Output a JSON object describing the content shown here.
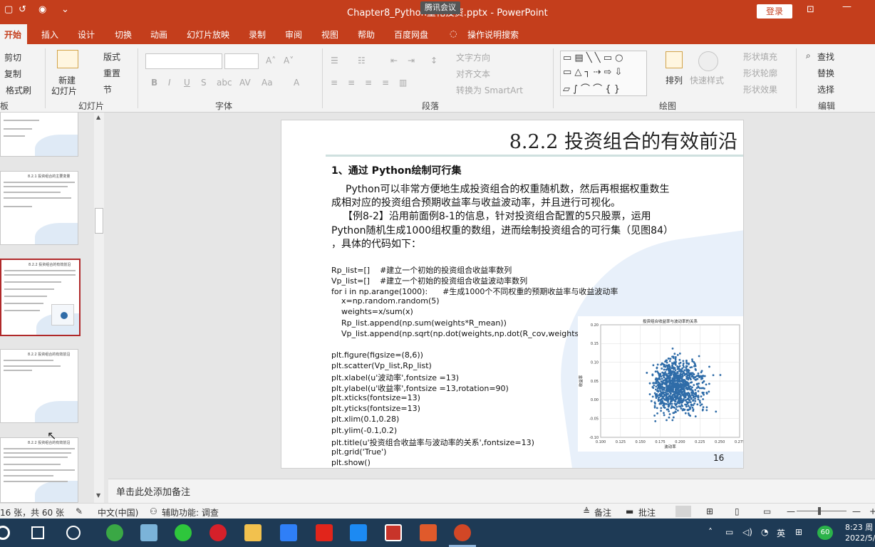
{
  "window": {
    "title": "Chapter8_Python量化投资.pptx - PowerPoint",
    "meeting_badge": "腾讯会议",
    "login_label": "登录"
  },
  "tabs": [
    {
      "label": "开始",
      "active": true
    },
    {
      "label": "插入"
    },
    {
      "label": "设计"
    },
    {
      "label": "切换"
    },
    {
      "label": "动画"
    },
    {
      "label": "幻灯片放映"
    },
    {
      "label": "录制"
    },
    {
      "label": "审阅"
    },
    {
      "label": "视图"
    },
    {
      "label": "帮助"
    },
    {
      "label": "百度网盘"
    },
    {
      "label": "操作说明搜索"
    }
  ],
  "ribbon": {
    "clipboard": {
      "cut": "剪切",
      "copy": "复制",
      "format_painter": "格式刷",
      "group": "板"
    },
    "slides": {
      "new_slide_1": "新建",
      "new_slide_2": "幻灯片",
      "layout": "版式",
      "reset": "重置",
      "section": "节",
      "group": "幻灯片"
    },
    "font": {
      "group": "字体"
    },
    "paragraph": {
      "text_direction": "文字方向",
      "align_text": "对齐文本",
      "convert_smartart": "转换为 SmartArt",
      "group": "段落"
    },
    "drawing": {
      "arrange": "排列",
      "quick_styles": "快速样式",
      "shape_fill": "形状填充",
      "shape_outline": "形状轮廓",
      "shape_effects": "形状效果",
      "group": "绘图"
    },
    "editing": {
      "find": "查找",
      "replace": "替换",
      "select": "选择",
      "group": "编辑"
    }
  },
  "thumbnails": [
    {
      "title": ""
    },
    {
      "title": "8.2.1 投资组合的主要变量"
    },
    {
      "title": "8.2.2 投资组合的有效前沿",
      "selected": true
    },
    {
      "title": "8.2.2 投资组合的有效前沿"
    },
    {
      "title": "8.2.2 投资组合的有效前沿"
    }
  ],
  "slide": {
    "title": "8.2.2  投资组合的有效前沿",
    "heading": "1、通过 Python绘制可行集",
    "para1_l1": "Python可以非常方便地生成投资组合的权重随机数，然后再根据权重数生",
    "para1_l2": "成相对应的投资组合预期收益率与收益波动率，并且进行可视化。",
    "para2_l1": "【例8-2】沿用前面例8-1的信息，针对投资组合配置的5只股票，运用",
    "para2_l2": "Python随机生成1000组权重的数组，进而绘制投资组合的可行集（见图84）",
    "para2_l3": "，具体的代码如下：",
    "code": [
      "Rp_list=[]    #建立一个初始的投资组合收益率数列",
      "Vp_list=[]    #建立一个初始的投资组合收益波动率数列",
      "for i in np.arange(1000):      #生成1000个不同权重的预期收益率与收益波动率",
      "    x=np.random.random(5)",
      "    weights=x/sum(x)",
      "    Rp_list.append(np.sum(weights*R_mean))",
      "    Vp_list.append(np.sqrt(np.dot(weights,np.dot(R_cov,weights.T))))",
      "",
      "plt.figure(figsize=(8,6))",
      "plt.scatter(Vp_list,Rp_list)",
      "plt.xlabel(u'波动率',fontsize =13)",
      "plt.ylabel(u'收益率',fontsize =13,rotation=90)",
      "plt.xticks(fontsize=13)",
      "plt.yticks(fontsize=13)",
      "plt.xlim(0.1,0.28)",
      "plt.ylim(-0.1,0.2)",
      "plt.title(u'投资组合收益率与波动率的关系',fontsize=13)",
      "plt.grid('True')",
      "plt.show()"
    ],
    "page_number": "16"
  },
  "chart_data": {
    "type": "scatter",
    "title": "投资组合收益率与波动率的关系",
    "xlabel": "波动率",
    "ylabel": "收益率",
    "xlim": [
      0.1,
      0.275
    ],
    "ylim": [
      -0.1,
      0.2
    ],
    "xticks": [
      "0.100",
      "0.125",
      "0.150",
      "0.175",
      "0.200",
      "0.225",
      "0.250",
      "0.275"
    ],
    "yticks": [
      "0.20",
      "0.15",
      "0.10",
      "0.05",
      "0.00",
      "-0.05",
      "-0.10"
    ],
    "grid": true,
    "color": "#2f6ca8",
    "cluster_center": [
      0.188,
      0.035
    ],
    "cluster_spread": [
      0.018,
      0.035
    ],
    "points": 1000
  },
  "notes": {
    "placeholder": "单击此处添加备注"
  },
  "status": {
    "slide_info": "16 张，共 60 张",
    "language": "中文(中国)",
    "accessibility": "辅助功能: 调查",
    "notes_btn": "备注",
    "comments_btn": "批注"
  },
  "taskbar": {
    "time": "8:23 周",
    "date": "2022/5/",
    "ime": "英",
    "battery": "60"
  }
}
